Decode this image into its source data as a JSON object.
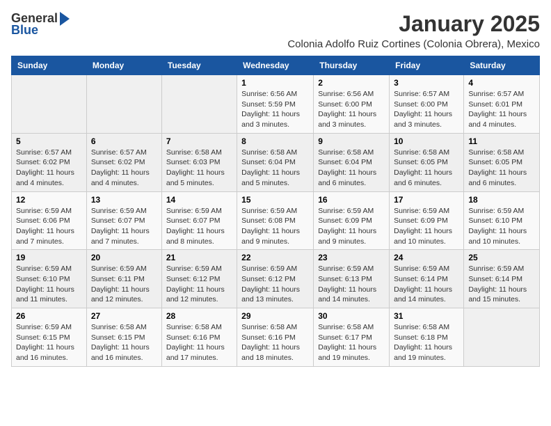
{
  "logo": {
    "line1": "General",
    "line2": "Blue"
  },
  "title": "January 2025",
  "subtitle": "Colonia Adolfo Ruiz Cortines (Colonia Obrera), Mexico",
  "weekdays": [
    "Sunday",
    "Monday",
    "Tuesday",
    "Wednesday",
    "Thursday",
    "Friday",
    "Saturday"
  ],
  "weeks": [
    [
      {
        "day": "",
        "info": ""
      },
      {
        "day": "",
        "info": ""
      },
      {
        "day": "",
        "info": ""
      },
      {
        "day": "1",
        "info": "Sunrise: 6:56 AM\nSunset: 5:59 PM\nDaylight: 11 hours and 3 minutes."
      },
      {
        "day": "2",
        "info": "Sunrise: 6:56 AM\nSunset: 6:00 PM\nDaylight: 11 hours and 3 minutes."
      },
      {
        "day": "3",
        "info": "Sunrise: 6:57 AM\nSunset: 6:00 PM\nDaylight: 11 hours and 3 minutes."
      },
      {
        "day": "4",
        "info": "Sunrise: 6:57 AM\nSunset: 6:01 PM\nDaylight: 11 hours and 4 minutes."
      }
    ],
    [
      {
        "day": "5",
        "info": "Sunrise: 6:57 AM\nSunset: 6:02 PM\nDaylight: 11 hours and 4 minutes."
      },
      {
        "day": "6",
        "info": "Sunrise: 6:57 AM\nSunset: 6:02 PM\nDaylight: 11 hours and 4 minutes."
      },
      {
        "day": "7",
        "info": "Sunrise: 6:58 AM\nSunset: 6:03 PM\nDaylight: 11 hours and 5 minutes."
      },
      {
        "day": "8",
        "info": "Sunrise: 6:58 AM\nSunset: 6:04 PM\nDaylight: 11 hours and 5 minutes."
      },
      {
        "day": "9",
        "info": "Sunrise: 6:58 AM\nSunset: 6:04 PM\nDaylight: 11 hours and 6 minutes."
      },
      {
        "day": "10",
        "info": "Sunrise: 6:58 AM\nSunset: 6:05 PM\nDaylight: 11 hours and 6 minutes."
      },
      {
        "day": "11",
        "info": "Sunrise: 6:58 AM\nSunset: 6:05 PM\nDaylight: 11 hours and 6 minutes."
      }
    ],
    [
      {
        "day": "12",
        "info": "Sunrise: 6:59 AM\nSunset: 6:06 PM\nDaylight: 11 hours and 7 minutes."
      },
      {
        "day": "13",
        "info": "Sunrise: 6:59 AM\nSunset: 6:07 PM\nDaylight: 11 hours and 7 minutes."
      },
      {
        "day": "14",
        "info": "Sunrise: 6:59 AM\nSunset: 6:07 PM\nDaylight: 11 hours and 8 minutes."
      },
      {
        "day": "15",
        "info": "Sunrise: 6:59 AM\nSunset: 6:08 PM\nDaylight: 11 hours and 9 minutes."
      },
      {
        "day": "16",
        "info": "Sunrise: 6:59 AM\nSunset: 6:09 PM\nDaylight: 11 hours and 9 minutes."
      },
      {
        "day": "17",
        "info": "Sunrise: 6:59 AM\nSunset: 6:09 PM\nDaylight: 11 hours and 10 minutes."
      },
      {
        "day": "18",
        "info": "Sunrise: 6:59 AM\nSunset: 6:10 PM\nDaylight: 11 hours and 10 minutes."
      }
    ],
    [
      {
        "day": "19",
        "info": "Sunrise: 6:59 AM\nSunset: 6:10 PM\nDaylight: 11 hours and 11 minutes."
      },
      {
        "day": "20",
        "info": "Sunrise: 6:59 AM\nSunset: 6:11 PM\nDaylight: 11 hours and 12 minutes."
      },
      {
        "day": "21",
        "info": "Sunrise: 6:59 AM\nSunset: 6:12 PM\nDaylight: 11 hours and 12 minutes."
      },
      {
        "day": "22",
        "info": "Sunrise: 6:59 AM\nSunset: 6:12 PM\nDaylight: 11 hours and 13 minutes."
      },
      {
        "day": "23",
        "info": "Sunrise: 6:59 AM\nSunset: 6:13 PM\nDaylight: 11 hours and 14 minutes."
      },
      {
        "day": "24",
        "info": "Sunrise: 6:59 AM\nSunset: 6:14 PM\nDaylight: 11 hours and 14 minutes."
      },
      {
        "day": "25",
        "info": "Sunrise: 6:59 AM\nSunset: 6:14 PM\nDaylight: 11 hours and 15 minutes."
      }
    ],
    [
      {
        "day": "26",
        "info": "Sunrise: 6:59 AM\nSunset: 6:15 PM\nDaylight: 11 hours and 16 minutes."
      },
      {
        "day": "27",
        "info": "Sunrise: 6:58 AM\nSunset: 6:15 PM\nDaylight: 11 hours and 16 minutes."
      },
      {
        "day": "28",
        "info": "Sunrise: 6:58 AM\nSunset: 6:16 PM\nDaylight: 11 hours and 17 minutes."
      },
      {
        "day": "29",
        "info": "Sunrise: 6:58 AM\nSunset: 6:16 PM\nDaylight: 11 hours and 18 minutes."
      },
      {
        "day": "30",
        "info": "Sunrise: 6:58 AM\nSunset: 6:17 PM\nDaylight: 11 hours and 19 minutes."
      },
      {
        "day": "31",
        "info": "Sunrise: 6:58 AM\nSunset: 6:18 PM\nDaylight: 11 hours and 19 minutes."
      },
      {
        "day": "",
        "info": ""
      }
    ]
  ]
}
